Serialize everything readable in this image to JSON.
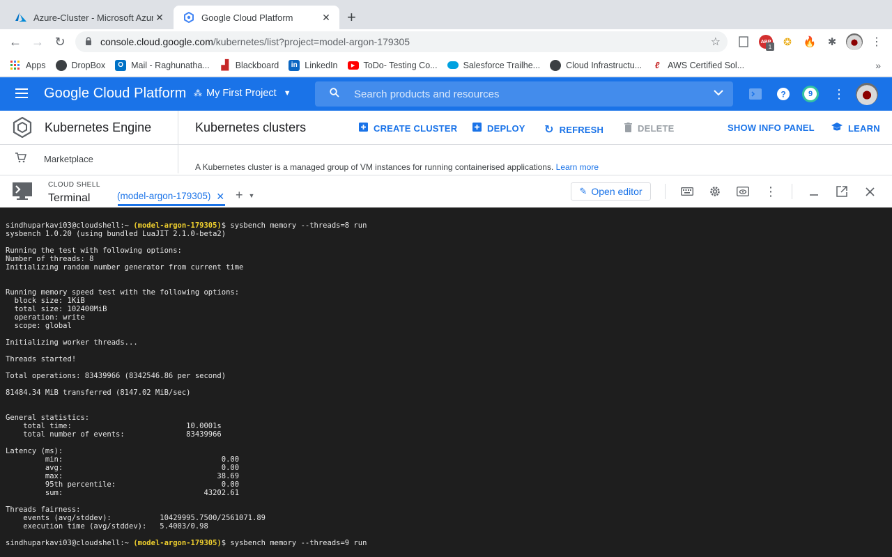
{
  "browser": {
    "tabs": [
      {
        "title": "Azure-Cluster - Microsoft Azure",
        "favicon": "azure-icon",
        "active": false
      },
      {
        "title": "Google Cloud Platform",
        "favicon": "gcp-icon",
        "active": true
      }
    ],
    "url_host": "console.cloud.google.com",
    "url_path": "/kubernetes/list?project=model-argon-179305",
    "extension_badge": "1",
    "bookmarks": [
      {
        "label": "Apps",
        "icon": "apps-grid-icon"
      },
      {
        "label": "DropBox",
        "icon": "globe-icon"
      },
      {
        "label": "Mail - Raghunatha...",
        "icon": "outlook-icon"
      },
      {
        "label": "Blackboard",
        "icon": "blackboard-icon"
      },
      {
        "label": "LinkedIn",
        "icon": "linkedin-icon"
      },
      {
        "label": "ToDo- Testing Co...",
        "icon": "youtube-icon"
      },
      {
        "label": "Salesforce Trailhe...",
        "icon": "salesforce-icon"
      },
      {
        "label": "Cloud Infrastructu...",
        "icon": "globe-icon"
      },
      {
        "label": "AWS Certified Sol...",
        "icon": "aws-icon"
      }
    ]
  },
  "gcp": {
    "title": "Google Cloud Platform",
    "project": "My First Project",
    "search_placeholder": "Search products and resources",
    "notifications_count": "9",
    "brand_color": "#1a73e8"
  },
  "kubernetes": {
    "product_name": "Kubernetes Engine",
    "sidebar_item": "Marketplace",
    "page_title": "Kubernetes clusters",
    "actions": {
      "create": "CREATE CLUSTER",
      "deploy": "DEPLOY",
      "refresh": "REFRESH",
      "delete": "DELETE",
      "info_panel": "SHOW INFO PANEL",
      "learn": "LEARN"
    },
    "description": "A Kubernetes cluster is a managed group of VM instances for running containerised applications.",
    "learn_more": "Learn more"
  },
  "cloud_shell": {
    "label": "CLOUD SHELL",
    "title": "Terminal",
    "tab_label": "(model-argon-179305)",
    "open_editor": "Open editor"
  },
  "terminal": {
    "prompt_user": "sindhuparkavi03@cloudshell:~",
    "prompt_project": "(model-argon-179305)",
    "first_command": "$ sysbench memory --threads=8 run",
    "last_command": "$ sysbench memory --threads=9 run",
    "output": [
      "sysbench 1.0.20 (using bundled LuaJIT 2.1.0-beta2)",
      "",
      "Running the test with following options:",
      "Number of threads: 8",
      "Initializing random number generator from current time",
      "",
      "",
      "Running memory speed test with the following options:",
      "  block size: 1KiB",
      "  total size: 102400MiB",
      "  operation: write",
      "  scope: global",
      "",
      "Initializing worker threads...",
      "",
      "Threads started!",
      "",
      "Total operations: 83439966 (8342546.86 per second)",
      "",
      "81484.34 MiB transferred (8147.02 MiB/sec)",
      "",
      "",
      "General statistics:",
      "    total time:                          10.0001s",
      "    total number of events:              83439966",
      "",
      "Latency (ms):",
      "         min:                                    0.00",
      "         avg:                                    0.00",
      "         max:                                   38.69",
      "         95th percentile:                        0.00",
      "         sum:                                43202.61",
      "",
      "Threads fairness:",
      "    events (avg/stddev):           10429995.7500/2561071.89",
      "    execution time (avg/stddev):   5.4003/0.98",
      ""
    ]
  }
}
